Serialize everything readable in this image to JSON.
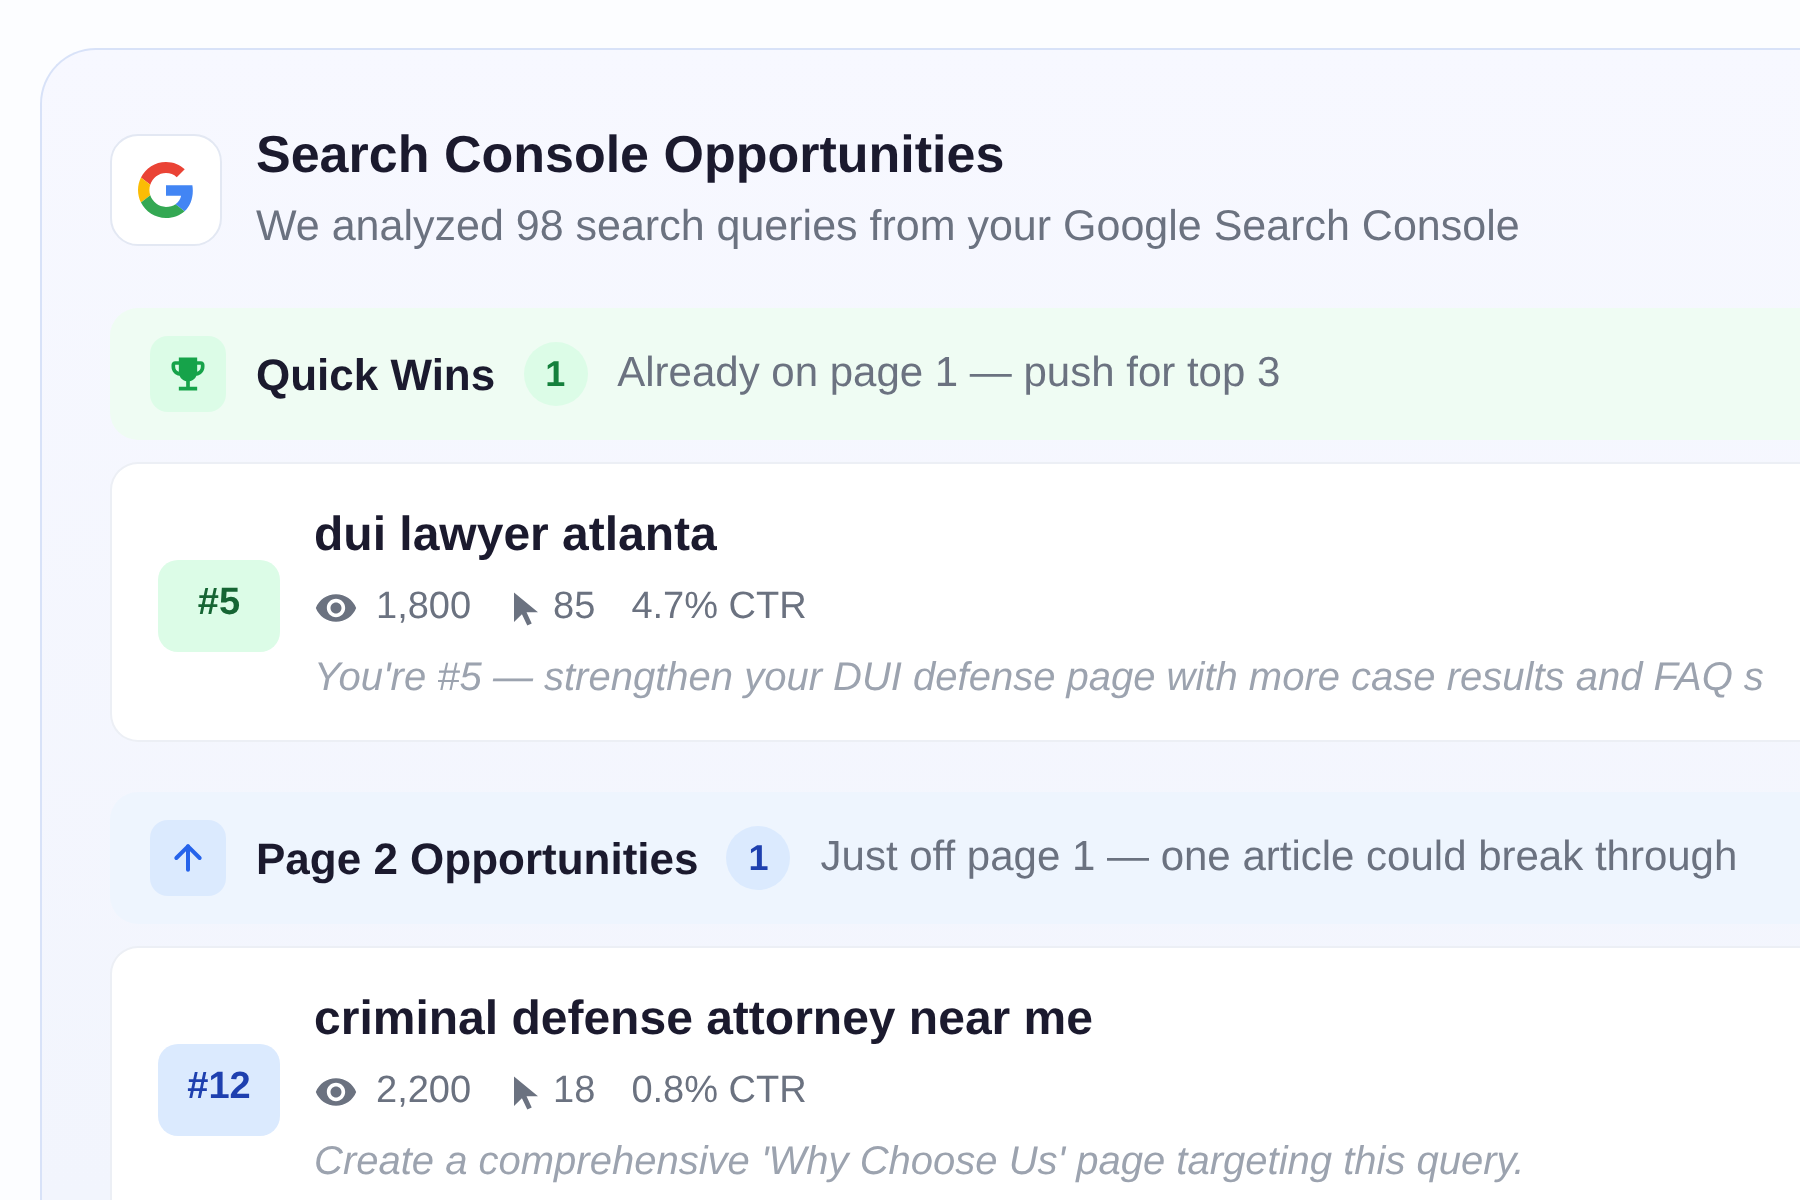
{
  "header": {
    "title": "Search Console Opportunities",
    "subtitle": "We analyzed 98 search queries from your Google Search Console"
  },
  "sections": [
    {
      "kind": "quick_wins",
      "title": "Quick Wins",
      "count": "1",
      "description": "Already on page 1 — push for top 3",
      "queries": [
        {
          "rank": "#5",
          "query": "dui lawyer atlanta",
          "impressions": "1,800",
          "clicks": "85",
          "ctr": "4.7% CTR",
          "note": "You're #5 — strengthen your DUI defense page with more case results and FAQ s"
        }
      ]
    },
    {
      "kind": "page_two",
      "title": "Page 2 Opportunities",
      "count": "1",
      "description": "Just off page 1 — one article could break through",
      "queries": [
        {
          "rank": "#12",
          "query": "criminal defense attorney near me",
          "impressions": "2,200",
          "clicks": "18",
          "ctr": "0.8% CTR",
          "note": "Create a comprehensive 'Why Choose Us' page targeting this query."
        }
      ]
    }
  ]
}
